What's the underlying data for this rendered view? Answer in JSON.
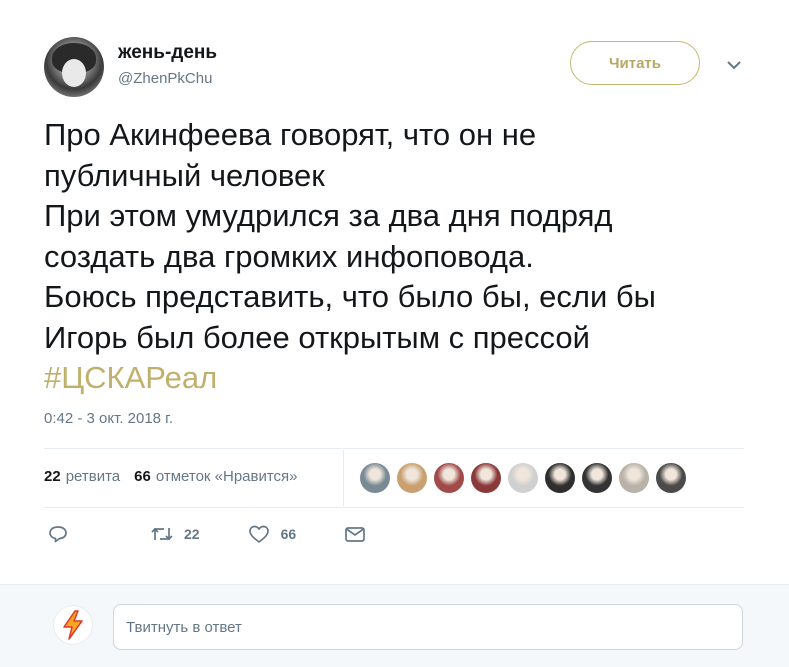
{
  "author": {
    "display_name": "жень-день",
    "handle": "@ZhenPkChu"
  },
  "follow_button_label": "Читать",
  "tweet": {
    "lines": [
      "Про Акинфеева говорят, что он не",
      "публичный человек",
      "При этом умудрился за два дня подряд",
      "создать два громких инфоповода.",
      "Боюсь представить, что было бы, если бы",
      "Игорь был более открытым с прессой"
    ],
    "hashtag": "#ЦСКАРеал",
    "timestamp": "0:42 - 3 окт. 2018 г."
  },
  "stats": {
    "retweets_count": "22",
    "retweets_label": "ретвита",
    "likes_count": "66",
    "likes_label": "отметок «Нравится»"
  },
  "liker_avatars": [
    "#7a8a95",
    "#c9a070",
    "#a04a4a",
    "#8a3838",
    "#d0d0d0",
    "#2e2e2e",
    "#333333",
    "#b8b2a8",
    "#4a4a4a"
  ],
  "actions": {
    "reply_count": "",
    "retweet_count": "22",
    "like_count": "66"
  },
  "reply": {
    "placeholder": "Твитнуть в ответ"
  },
  "colors": {
    "accent_gold": "#c1b06c",
    "secondary_text": "#657786",
    "divider": "#e6ecf0"
  },
  "icons": [
    "chevron-down-icon",
    "reply-icon",
    "retweet-icon",
    "like-icon",
    "direct-message-icon",
    "lightning-avatar-icon"
  ]
}
